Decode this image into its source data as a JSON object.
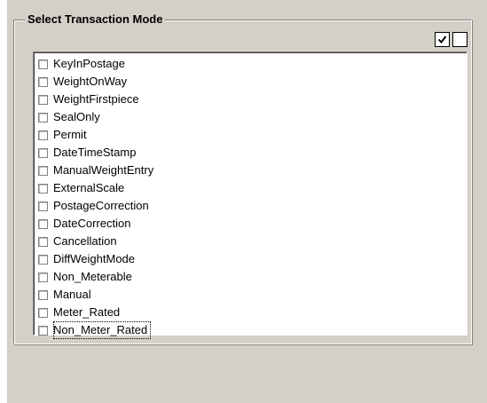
{
  "group": {
    "title": "Select Transaction Mode"
  },
  "toolbar": {
    "select_all_icon": "checked-box-icon",
    "select_none_icon": "empty-box-icon"
  },
  "modes": [
    {
      "label": "KeyInPostage",
      "checked": false
    },
    {
      "label": "WeightOnWay",
      "checked": false
    },
    {
      "label": "WeightFirstpiece",
      "checked": false
    },
    {
      "label": "SealOnly",
      "checked": false
    },
    {
      "label": "Permit",
      "checked": false
    },
    {
      "label": "DateTimeStamp",
      "checked": false
    },
    {
      "label": "ManualWeightEntry",
      "checked": false
    },
    {
      "label": "ExternalScale",
      "checked": false
    },
    {
      "label": "PostageCorrection",
      "checked": false
    },
    {
      "label": "DateCorrection",
      "checked": false
    },
    {
      "label": "Cancellation",
      "checked": false
    },
    {
      "label": "DiffWeightMode",
      "checked": false
    },
    {
      "label": "Non_Meterable",
      "checked": false
    },
    {
      "label": "Manual",
      "checked": false
    },
    {
      "label": "Meter_Rated",
      "checked": false
    },
    {
      "label": "Non_Meter_Rated",
      "checked": false
    }
  ]
}
